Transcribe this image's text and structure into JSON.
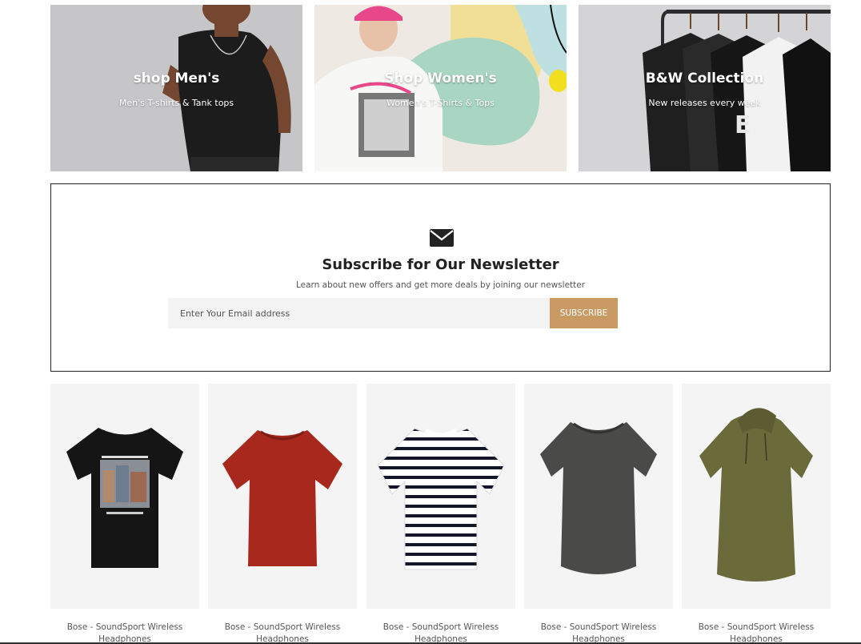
{
  "banners": [
    {
      "title": "shop Men's",
      "subtitle": "Men's T-shirts & Tank tops"
    },
    {
      "title": "Shop Women's",
      "subtitle": "Women's T-Shirts & Tops"
    },
    {
      "title": "B&W Collection",
      "subtitle": "New releases every week"
    }
  ],
  "newsletter": {
    "icon": "envelope-icon",
    "title": "Subscribe for Our Newsletter",
    "subtitle": "Learn about new offers and get more deals by joining our newsletter",
    "email_placeholder": "Enter Your Email address",
    "subscribe_label": "SUBSCRIBE",
    "button_color": "#c99a63"
  },
  "products": [
    {
      "name": "Bose - SoundSport Wireless Headphones",
      "shirt_color": "#151515",
      "style": "graphic-tee"
    },
    {
      "name": "Bose - SoundSport Wireless Headphones",
      "shirt_color": "#a8281e",
      "style": "plain-tee"
    },
    {
      "name": "Bose - SoundSport Wireless Headphones",
      "shirt_color": "#ffffff",
      "style": "striped-tee"
    },
    {
      "name": "Bose - SoundSport Wireless Headphones",
      "shirt_color": "#4a4a48",
      "style": "scoop-tee"
    },
    {
      "name": "Bose - SoundSport Wireless Headphones",
      "shirt_color": "#6b6a3a",
      "style": "hooded-tee"
    }
  ]
}
